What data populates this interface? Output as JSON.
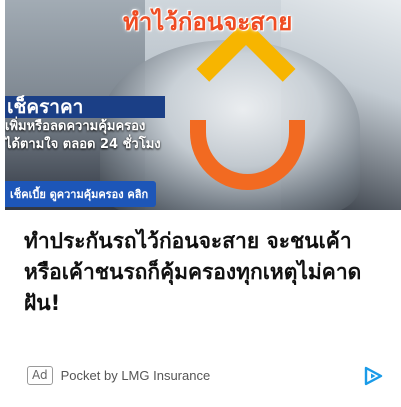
{
  "ad": {
    "image_headline": "ทำไว้ก่อนจะสาย",
    "image_text_line1": "เช็คราคา",
    "image_text_line2": "เพิ่มหรือลดความคุ้มครอง",
    "image_text_line3": "ได้ตามใจ ตลอด 24 ชั่วโมง",
    "image_cta": "เช็คเบี้ย ดูความคุ้มครอง คลิก",
    "headline": "ทำประกันรถไว้ก่อนจะสาย จะชนเค้าหรือเค้าชนรถก็คุ้มครองทุกเหตุไม่คาดฝัน!",
    "badge": "Ad",
    "sponsor": "Pocket by LMG Insurance",
    "adchoices_icon": "adchoices-triangle-icon"
  },
  "colors": {
    "headline_orange": "#ef4c23",
    "roof_yellow": "#f7b500",
    "smile_orange": "#f26a21",
    "cta_blue": "#1d56b8",
    "adchoices_blue": "#1a9be8"
  }
}
